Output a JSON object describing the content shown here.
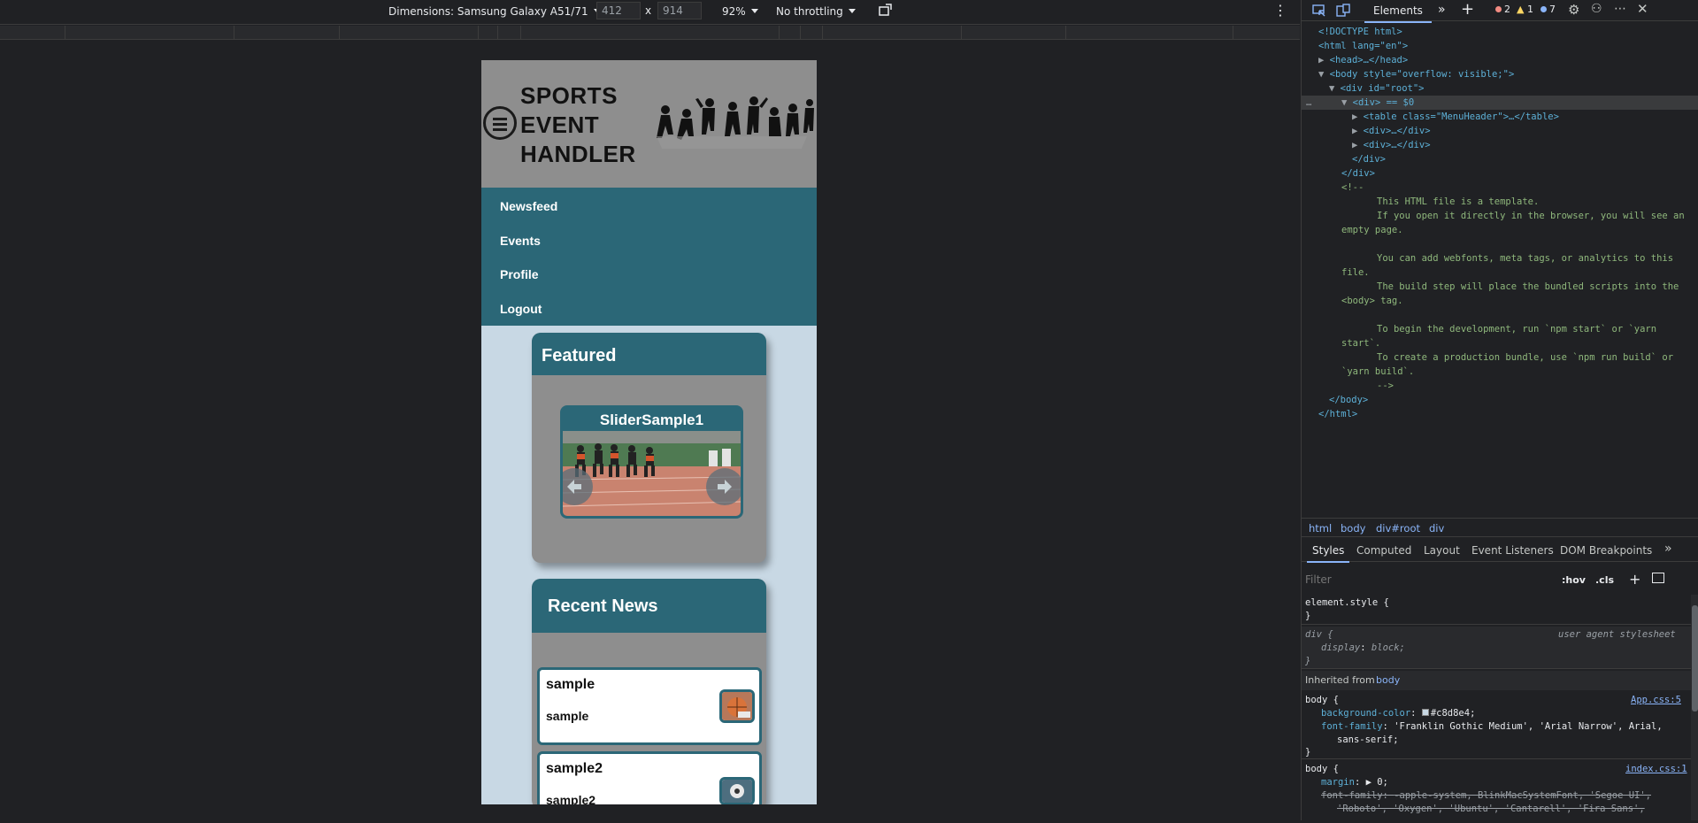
{
  "device_toolbar": {
    "dimensions_label": "Dimensions: Samsung Galaxy A51/71",
    "width_value": "412",
    "height_value": "914",
    "times": "x",
    "zoom": "92%",
    "throttling": "No throttling",
    "more": "⋮"
  },
  "site": {
    "title_line1": "SPORTS",
    "title_line2": "EVENT",
    "title_line3": "HANDLER",
    "nav": [
      "Newsfeed",
      "Events",
      "Profile",
      "Logout"
    ],
    "featured": {
      "heading": "Featured",
      "slide_title": "SliderSample1"
    },
    "recent_news": {
      "heading": "Recent News",
      "items": [
        {
          "title": "sample",
          "subtitle": "sample"
        },
        {
          "title": "sample2",
          "subtitle": "sample2"
        }
      ]
    }
  },
  "devtools": {
    "tabs": {
      "elements": "Elements"
    },
    "badges": {
      "errors": "2",
      "warnings": "1",
      "info": "7"
    },
    "dom_lines": {
      "doctype": "<!DOCTYPE html>",
      "html_open": "<html lang=\"en\">",
      "head": "<head>…</head>",
      "body_open": "<body style=\"overflow: visible;\">",
      "root_open": "<div id=\"root\">",
      "div_selected": "<div> == $0",
      "table": "<table class=\"MenuHeader\">…</table>",
      "div1": "<div>…</div>",
      "div2": "<div>…</div>",
      "div_close": "</div>",
      "root_close": "</div>",
      "comment_open": "<!--",
      "c1": "This HTML file is a template.",
      "c2": "If you open it directly in the browser, you will see an",
      "c3": "empty page.",
      "c4": "You can add webfonts, meta tags, or analytics to this",
      "c5": "file.",
      "c6": "The build step will place the bundled scripts into the",
      "c7": "<body> tag.",
      "c8": "To begin the development, run `npm start` or `yarn",
      "c9": "start`.",
      "c10": "To create a production bundle, use `npm run build` or",
      "c11": "`yarn build`.",
      "comment_close": "-->",
      "body_close": "</body>",
      "html_close": "</html>"
    },
    "breadcrumbs": [
      "html",
      "body",
      "div#root",
      "div"
    ],
    "style_tabs": [
      "Styles",
      "Computed",
      "Layout",
      "Event Listeners",
      "DOM Breakpoints"
    ],
    "filter_placeholder": "Filter",
    "hov": ":hov",
    "cls": ".cls",
    "rules": {
      "element_style": "element.style {",
      "close_brace": "}",
      "div_selector": "div {",
      "ua_label": "user agent stylesheet",
      "display_prop": "display",
      "display_val": "block;",
      "inherited_label": "Inherited from",
      "inherited_from": "body",
      "body_selector": "body {",
      "app_css": "App.css:5",
      "bg_prop": "background-color",
      "bg_val": "#c8d8e4;",
      "ff_prop": "font-family",
      "ff_val": "'Franklin Gothic Medium', 'Arial Narrow', Arial,",
      "ff_val2": "sans-serif;",
      "index_css": "index.css:1",
      "margin_prop": "margin",
      "margin_val": "▶ 0;",
      "ff2_val": "-apple-system, BlinkMacSystemFont, 'Segoe UI',",
      "ff2_val2": "'Roboto', 'Oxygen', 'Ubuntu', 'Cantarell', 'Fira Sans',"
    }
  },
  "colors": {
    "accent": "#2b6777",
    "page_bg": "#c8d8e4",
    "header_bg": "#8e8e8e"
  }
}
